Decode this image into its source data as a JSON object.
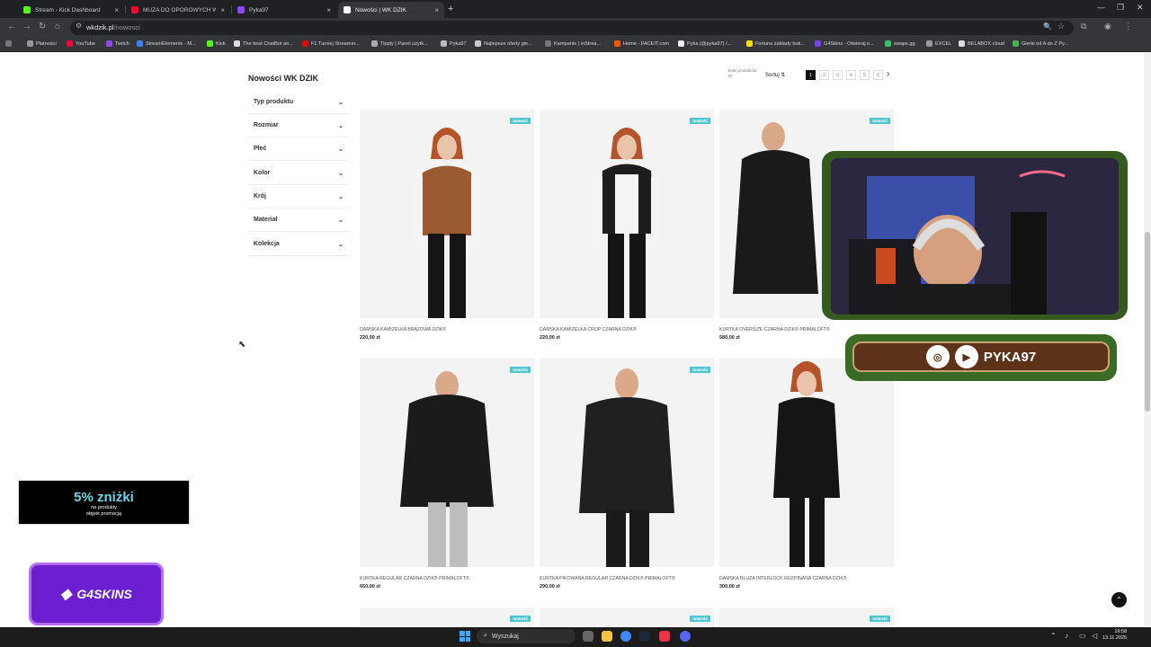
{
  "browser": {
    "tabs": [
      {
        "label": "Stream - Kick Dashboard",
        "color": "#53fc18"
      },
      {
        "label": "MUZA DO OPOROWYCH W...",
        "color": "#ff0033"
      },
      {
        "label": "Pyka97",
        "color": "#9146ff"
      },
      {
        "label": "Nowości | WK DZIK",
        "color": "#ffffff"
      }
    ],
    "url_host": "wkdzik.pl",
    "url_path": "/nowosci",
    "bookmarks": [
      "Płatności",
      "YouTube",
      "Twitch",
      "StreamElements - M...",
      "Kick",
      "The best ChatBot an...",
      "F1 Turniej Streamer...",
      "Tipply | Panel użytk...",
      "Pyka97",
      "Najlepsze oferty gie...",
      "Kampanie | inStrea...",
      "Home - FACEIT.com",
      "Pyka (@pyka97) /...",
      "Fortuna zakłady buk...",
      "G4Skins - Otwieraj s...",
      "swapx.gg",
      "EXCEL",
      "BELABOX cloud",
      "Gierki od A do Z Py..."
    ]
  },
  "page": {
    "title": "Nowości WK DZIK",
    "count_label": "Ilość produktów: 97",
    "sort_label": "Sortuj",
    "pages": [
      "1",
      "2",
      "3",
      "4",
      "5",
      "6"
    ],
    "filters": [
      "Typ produktu",
      "Rozmiar",
      "Płeć",
      "Kolor",
      "Krój",
      "Materiał",
      "Kolekcja"
    ],
    "badge": "nowość",
    "products": [
      {
        "name": "DAMSKA KAMIZELKA BRĄZOWA DZIK®",
        "price": "220,00 zł"
      },
      {
        "name": "DAMSKA KAMIZELKA CROP CZARNA DZIK®",
        "price": "220,00 zł"
      },
      {
        "name": "KURTKA OVERSIZE CZARNA DZIK® PRIMALOFT®",
        "price": "580,00 zł"
      },
      {
        "name": "KURTKA REGULAR CZARNA DZIK® PRIMALOFT®",
        "price": "650,00 zł"
      },
      {
        "name": "KURTKA PIKOWANA REGULAR CZARNA DZIK® PRIMALOFT®",
        "price": "290,00 zł"
      },
      {
        "name": "DAMSKA BLUZA INTERLOCK ROZPINANA CZARNA DZIK®",
        "price": "300,00 zł"
      }
    ]
  },
  "overlay": {
    "handle": "PYKA97",
    "promo_big": "5% zniżki",
    "promo_small_1": "na produkty",
    "promo_small_2": "objęte promocją",
    "g4_label": "G4SKINS"
  },
  "taskbar": {
    "search": "Wyszukaj",
    "time": "19:58",
    "date": "13.11.2025"
  }
}
